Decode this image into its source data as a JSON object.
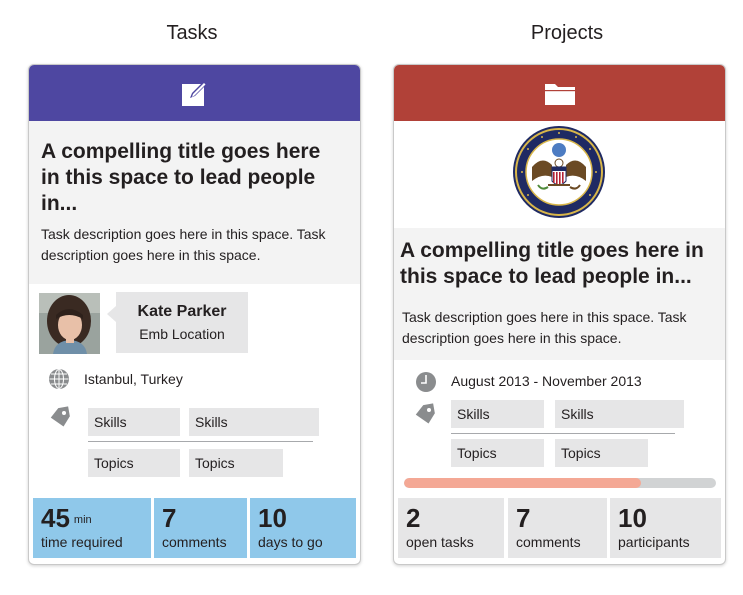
{
  "columns": {
    "tasks_title": "Tasks",
    "projects_title": "Projects"
  },
  "task_card": {
    "header_color": "#4e47a1",
    "header_icon": "edit-icon",
    "title": "A compelling title goes here in this space to lead people in...",
    "title_lines": [
      "A compelling title goes here",
      "in this space to lead people",
      "in..."
    ],
    "description_lines": [
      "Task description goes here in this space. Task",
      "description goes here in this space."
    ],
    "person": {
      "name": "Kate Parker",
      "location": "Emb Location"
    },
    "place": "Istanbul, Turkey",
    "place_icon": "globe-icon",
    "tag_icon": "tag-icon",
    "skills": [
      "Skills",
      "Skills"
    ],
    "topics": [
      "Topics",
      "Topics"
    ],
    "stats_color": "#8fc8ea",
    "stats": [
      {
        "value": "45",
        "unit": "min",
        "label": "time required"
      },
      {
        "value": "7",
        "label": "comments"
      },
      {
        "value": "10",
        "label": "days to go"
      }
    ]
  },
  "project_card": {
    "header_color": "#b14138",
    "header_icon": "folder-icon",
    "seal_text": "DEPARTMENT OF STATE · UNITED STATES OF AMERICA",
    "title_lines": [
      "A compelling title goes here in",
      "this space to lead people in..."
    ],
    "description_lines": [
      "Task description goes here in this space. Task",
      "description goes here in this space."
    ],
    "date_range": "August 2013 - November 2013",
    "date_icon": "clock-icon",
    "tag_icon": "tag-icon",
    "skills": [
      "Skills",
      "Skills"
    ],
    "topics": [
      "Topics",
      "Topics"
    ],
    "progress": 0.76,
    "progress_color": "#f4a895",
    "progress_track_color": "#d1d3d4",
    "stats_color": "#e6e6e7",
    "stats": [
      {
        "value": "2",
        "label": "open tasks"
      },
      {
        "value": "7",
        "label": "comments"
      },
      {
        "value": "10",
        "label": "participants"
      }
    ]
  }
}
